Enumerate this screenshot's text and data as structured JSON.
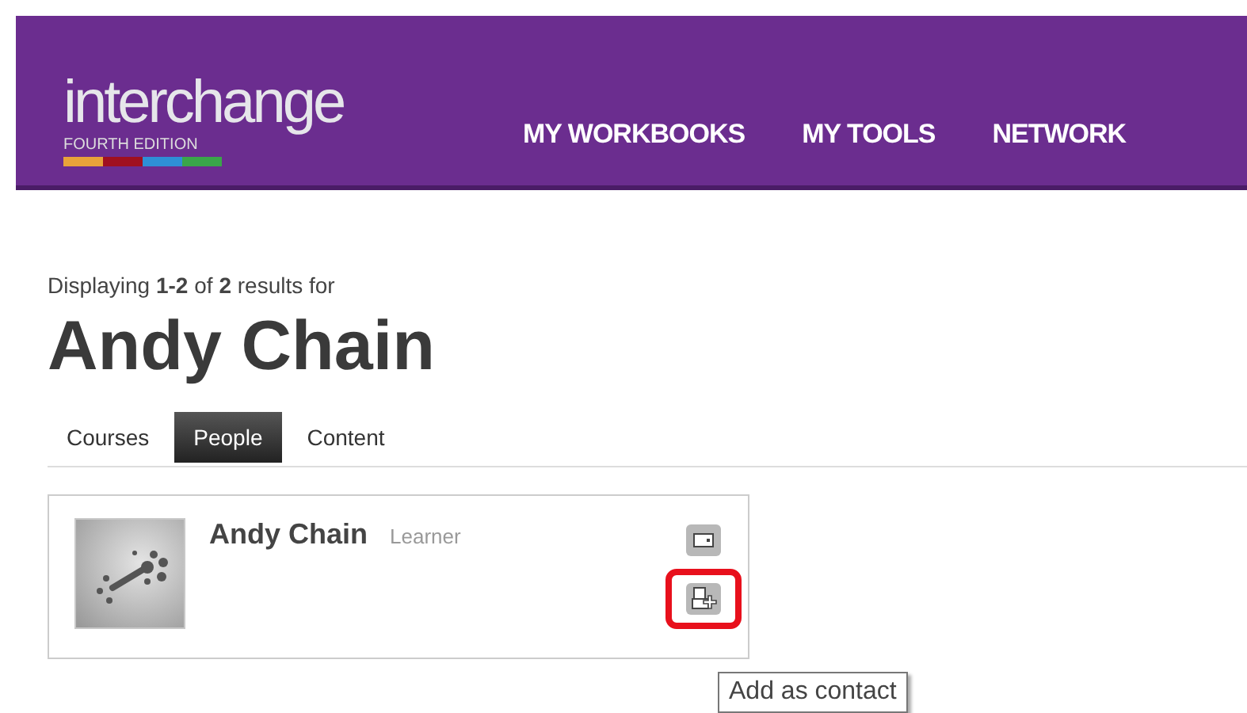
{
  "header": {
    "logo": "interchange",
    "edition": "FOURTH EDITION",
    "nav": [
      {
        "label": "MY WORKBOOKS"
      },
      {
        "label": "MY TOOLS"
      },
      {
        "label": "NETWORK"
      }
    ]
  },
  "summary": "Displaying **1-2** of **2** results for",
  "query": "Andy Chain",
  "tabs": [
    {
      "label": "Courses",
      "selected": false
    },
    {
      "label": "People",
      "selected": true
    },
    {
      "label": "Content",
      "selected": false
    }
  ],
  "results": [
    {
      "name": "Andy Chain",
      "role": "Learner",
      "actions": [
        {
          "kind": "card",
          "highlighted": false
        },
        {
          "kind": "add-contact",
          "highlighted": true
        }
      ]
    }
  ],
  "tooltip": "Add as contact"
}
